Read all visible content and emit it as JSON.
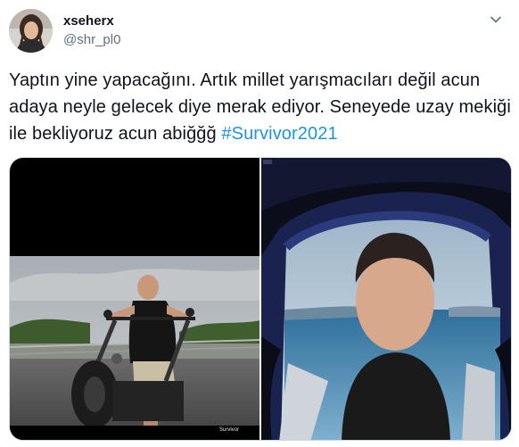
{
  "tweet": {
    "author": {
      "display_name": "xseherx",
      "handle": "@shr_pl0",
      "avatar_icon": "avatar-photo"
    },
    "text": "Yaptın yine yapacağını. Artık millet yarışmacıları değil acun adaya neyle gelecek diye merak ediyor. Seneyede uzay mekiği ile bekliyoruz acun abiğğğ ",
    "hashtag": "#Survivor2021",
    "more_icon": "chevron-down-icon",
    "media": [
      {
        "name": "motorcycle-photo",
        "watermark": "Survivor"
      },
      {
        "name": "cockpit-photo",
        "watermark": ""
      }
    ]
  },
  "colors": {
    "text": "#0f1419",
    "secondary": "#5b7083",
    "link": "#1b95e0",
    "border": "#cfd9de"
  }
}
